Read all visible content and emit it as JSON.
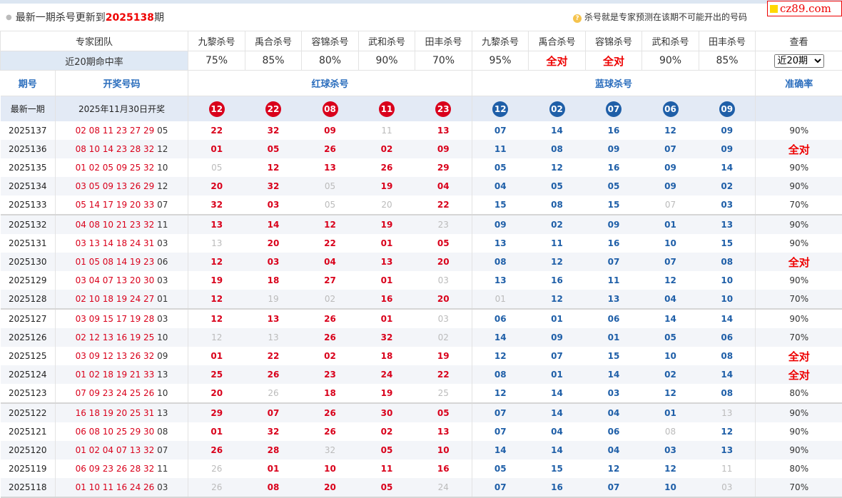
{
  "header": {
    "prefix": "最新一期杀号更新到",
    "issue": "2025138",
    "suffix": "期",
    "note": "杀号就是专家预测在该期不可能开出的号码",
    "logo": "cz89.com"
  },
  "team": {
    "label": "专家团队",
    "experts": [
      "九黎杀号",
      "禹合杀号",
      "容锦杀号",
      "武和杀号",
      "田丰杀号",
      "九黎杀号",
      "禹合杀号",
      "容锦杀号",
      "武和杀号",
      "田丰杀号"
    ],
    "view_label": "查看"
  },
  "rate": {
    "label": "近20期命中率",
    "values": [
      "75%",
      "85%",
      "80%",
      "90%",
      "70%",
      "95%",
      "全对",
      "全对",
      "90%",
      "85%"
    ],
    "select_value": "近20期",
    "select_options": [
      "近20期"
    ]
  },
  "columns": {
    "issue": "期号",
    "open": "开奖号码",
    "red": "红球杀号",
    "blue": "蓝球杀号",
    "accuracy": "准确率"
  },
  "latest": {
    "label": "最新一期",
    "date": "2025年11月30日开奖",
    "red": [
      "12",
      "22",
      "08",
      "11",
      "23"
    ],
    "blue": [
      "12",
      "02",
      "07",
      "06",
      "09"
    ]
  },
  "rows": [
    {
      "issue": "2025137",
      "red_open": "02 08 11 23 27 29",
      "blue_open": "05",
      "red": [
        "22",
        "32",
        "09",
        "11",
        "13"
      ],
      "red_miss": [
        0,
        0,
        0,
        1,
        0
      ],
      "blue": [
        "07",
        "14",
        "16",
        "12",
        "09"
      ],
      "blue_miss": [
        0,
        0,
        0,
        0,
        0
      ],
      "acc": "90%"
    },
    {
      "issue": "2025136",
      "red_open": "08 10 14 23 28 32",
      "blue_open": "12",
      "red": [
        "01",
        "05",
        "26",
        "02",
        "09"
      ],
      "red_miss": [
        0,
        0,
        0,
        0,
        0
      ],
      "blue": [
        "11",
        "08",
        "09",
        "07",
        "09"
      ],
      "blue_miss": [
        0,
        0,
        0,
        0,
        0
      ],
      "acc": "全对"
    },
    {
      "issue": "2025135",
      "red_open": "01 02 05 09 25 32",
      "blue_open": "10",
      "red": [
        "05",
        "12",
        "13",
        "26",
        "29"
      ],
      "red_miss": [
        1,
        0,
        0,
        0,
        0
      ],
      "blue": [
        "05",
        "12",
        "16",
        "09",
        "14"
      ],
      "blue_miss": [
        0,
        0,
        0,
        0,
        0
      ],
      "acc": "90%"
    },
    {
      "issue": "2025134",
      "red_open": "03 05 09 13 26 29",
      "blue_open": "12",
      "red": [
        "20",
        "32",
        "05",
        "19",
        "04"
      ],
      "red_miss": [
        0,
        0,
        1,
        0,
        0
      ],
      "blue": [
        "04",
        "05",
        "05",
        "09",
        "02"
      ],
      "blue_miss": [
        0,
        0,
        0,
        0,
        0
      ],
      "acc": "90%"
    },
    {
      "issue": "2025133",
      "red_open": "05 14 17 19 20 33",
      "blue_open": "07",
      "red": [
        "32",
        "03",
        "05",
        "20",
        "22"
      ],
      "red_miss": [
        0,
        0,
        1,
        1,
        0
      ],
      "blue": [
        "15",
        "08",
        "15",
        "07",
        "03"
      ],
      "blue_miss": [
        0,
        0,
        0,
        1,
        0
      ],
      "acc": "70%"
    },
    {
      "issue": "2025132",
      "red_open": "04 08 10 21 23 32",
      "blue_open": "11",
      "red": [
        "13",
        "14",
        "12",
        "19",
        "23"
      ],
      "red_miss": [
        0,
        0,
        0,
        0,
        1
      ],
      "blue": [
        "09",
        "02",
        "09",
        "01",
        "13"
      ],
      "blue_miss": [
        0,
        0,
        0,
        0,
        0
      ],
      "acc": "90%"
    },
    {
      "issue": "2025131",
      "red_open": "03 13 14 18 24 31",
      "blue_open": "03",
      "red": [
        "13",
        "20",
        "22",
        "01",
        "05"
      ],
      "red_miss": [
        1,
        0,
        0,
        0,
        0
      ],
      "blue": [
        "13",
        "11",
        "16",
        "10",
        "15"
      ],
      "blue_miss": [
        0,
        0,
        0,
        0,
        0
      ],
      "acc": "90%"
    },
    {
      "issue": "2025130",
      "red_open": "01 05 08 14 19 23",
      "blue_open": "06",
      "red": [
        "12",
        "03",
        "04",
        "13",
        "20"
      ],
      "red_miss": [
        0,
        0,
        0,
        0,
        0
      ],
      "blue": [
        "08",
        "12",
        "07",
        "07",
        "08"
      ],
      "blue_miss": [
        0,
        0,
        0,
        0,
        0
      ],
      "acc": "全对"
    },
    {
      "issue": "2025129",
      "red_open": "03 04 07 13 20 30",
      "blue_open": "03",
      "red": [
        "19",
        "18",
        "27",
        "01",
        "03"
      ],
      "red_miss": [
        0,
        0,
        0,
        0,
        1
      ],
      "blue": [
        "13",
        "16",
        "11",
        "12",
        "10"
      ],
      "blue_miss": [
        0,
        0,
        0,
        0,
        0
      ],
      "acc": "90%"
    },
    {
      "issue": "2025128",
      "red_open": "02 10 18 19 24 27",
      "blue_open": "01",
      "red": [
        "12",
        "19",
        "02",
        "16",
        "20"
      ],
      "red_miss": [
        0,
        1,
        1,
        0,
        0
      ],
      "blue": [
        "01",
        "12",
        "13",
        "04",
        "10"
      ],
      "blue_miss": [
        1,
        0,
        0,
        0,
        0
      ],
      "acc": "70%"
    },
    {
      "issue": "2025127",
      "red_open": "03 09 15 17 19 28",
      "blue_open": "03",
      "red": [
        "12",
        "13",
        "26",
        "01",
        "03"
      ],
      "red_miss": [
        0,
        0,
        0,
        0,
        1
      ],
      "blue": [
        "06",
        "01",
        "06",
        "14",
        "14"
      ],
      "blue_miss": [
        0,
        0,
        0,
        0,
        0
      ],
      "acc": "90%"
    },
    {
      "issue": "2025126",
      "red_open": "02 12 13 16 19 25",
      "blue_open": "10",
      "red": [
        "12",
        "13",
        "26",
        "32",
        "02"
      ],
      "red_miss": [
        1,
        1,
        0,
        0,
        1
      ],
      "blue": [
        "14",
        "09",
        "01",
        "05",
        "06"
      ],
      "blue_miss": [
        0,
        0,
        0,
        0,
        0
      ],
      "acc": "70%"
    },
    {
      "issue": "2025125",
      "red_open": "03 09 12 13 26 32",
      "blue_open": "09",
      "red": [
        "01",
        "22",
        "02",
        "18",
        "19"
      ],
      "red_miss": [
        0,
        0,
        0,
        0,
        0
      ],
      "blue": [
        "12",
        "07",
        "15",
        "10",
        "08"
      ],
      "blue_miss": [
        0,
        0,
        0,
        0,
        0
      ],
      "acc": "全对"
    },
    {
      "issue": "2025124",
      "red_open": "01 02 18 19 21 33",
      "blue_open": "13",
      "red": [
        "25",
        "26",
        "23",
        "24",
        "22"
      ],
      "red_miss": [
        0,
        0,
        0,
        0,
        0
      ],
      "blue": [
        "08",
        "01",
        "14",
        "02",
        "14"
      ],
      "blue_miss": [
        0,
        0,
        0,
        0,
        0
      ],
      "acc": "全对"
    },
    {
      "issue": "2025123",
      "red_open": "07 09 23 24 25 26",
      "blue_open": "10",
      "red": [
        "20",
        "26",
        "18",
        "19",
        "25"
      ],
      "red_miss": [
        0,
        1,
        0,
        0,
        1
      ],
      "blue": [
        "12",
        "14",
        "03",
        "12",
        "08"
      ],
      "blue_miss": [
        0,
        0,
        0,
        0,
        0
      ],
      "acc": "80%"
    },
    {
      "issue": "2025122",
      "red_open": "16 18 19 20 25 31",
      "blue_open": "13",
      "red": [
        "29",
        "07",
        "26",
        "30",
        "05"
      ],
      "red_miss": [
        0,
        0,
        0,
        0,
        0
      ],
      "blue": [
        "07",
        "14",
        "04",
        "01",
        "13"
      ],
      "blue_miss": [
        0,
        0,
        0,
        0,
        1
      ],
      "acc": "90%"
    },
    {
      "issue": "2025121",
      "red_open": "06 08 10 25 29 30",
      "blue_open": "08",
      "red": [
        "01",
        "32",
        "26",
        "02",
        "13"
      ],
      "red_miss": [
        0,
        0,
        0,
        0,
        0
      ],
      "blue": [
        "07",
        "04",
        "06",
        "08",
        "12"
      ],
      "blue_miss": [
        0,
        0,
        0,
        1,
        0
      ],
      "acc": "90%"
    },
    {
      "issue": "2025120",
      "red_open": "01 02 04 07 13 32",
      "blue_open": "07",
      "red": [
        "26",
        "28",
        "32",
        "05",
        "10"
      ],
      "red_miss": [
        0,
        0,
        1,
        0,
        0
      ],
      "blue": [
        "14",
        "14",
        "04",
        "03",
        "13"
      ],
      "blue_miss": [
        0,
        0,
        0,
        0,
        0
      ],
      "acc": "90%"
    },
    {
      "issue": "2025119",
      "red_open": "06 09 23 26 28 32",
      "blue_open": "11",
      "red": [
        "26",
        "01",
        "10",
        "11",
        "16"
      ],
      "red_miss": [
        1,
        0,
        0,
        0,
        0
      ],
      "blue": [
        "05",
        "15",
        "12",
        "12",
        "11"
      ],
      "blue_miss": [
        0,
        0,
        0,
        0,
        1
      ],
      "acc": "80%"
    },
    {
      "issue": "2025118",
      "red_open": "01 10 11 16 24 26",
      "blue_open": "03",
      "red": [
        "26",
        "08",
        "20",
        "05",
        "24"
      ],
      "red_miss": [
        1,
        0,
        0,
        0,
        1
      ],
      "blue": [
        "07",
        "16",
        "07",
        "10",
        "03"
      ],
      "blue_miss": [
        0,
        0,
        0,
        0,
        1
      ],
      "acc": "70%"
    }
  ]
}
